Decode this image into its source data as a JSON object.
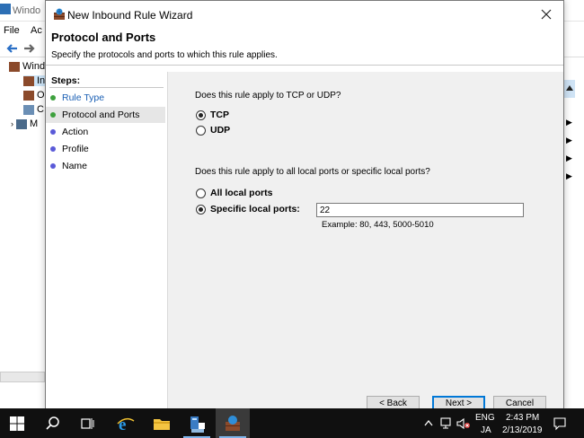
{
  "background_window": {
    "title": "Windo",
    "menu": [
      "File",
      "Ac"
    ],
    "tree_items": [
      "Wind",
      "In",
      "O",
      "C",
      "M"
    ]
  },
  "wizard": {
    "title": "New Inbound Rule Wizard",
    "heading": "Protocol and Ports",
    "subheading": "Specify the protocols and ports to which this rule applies.",
    "steps_title": "Steps:",
    "steps": [
      {
        "label": "Rule Type",
        "state": "done",
        "color": "#3ea13e"
      },
      {
        "label": "Protocol and Ports",
        "state": "current",
        "color": "#3ea13e"
      },
      {
        "label": "Action",
        "state": "pending",
        "color": "#5a5ad8"
      },
      {
        "label": "Profile",
        "state": "pending",
        "color": "#5a5ad8"
      },
      {
        "label": "Name",
        "state": "pending",
        "color": "#5a5ad8"
      }
    ],
    "protocol_question": "Does this rule apply to TCP or UDP?",
    "protocol_options": [
      "TCP",
      "UDP"
    ],
    "protocol_selected": "TCP",
    "ports_question": "Does this rule apply to all local ports or specific local ports?",
    "ports_options": [
      "All local ports",
      "Specific local ports:"
    ],
    "ports_selected": "Specific local ports:",
    "ports_value": "22",
    "ports_example": "Example: 80, 443, 5000-5010",
    "buttons": {
      "back": "< Back",
      "next": "Next >",
      "cancel": "Cancel"
    }
  },
  "taskbar": {
    "language": "ENG",
    "ime": "JA",
    "time": "2:43 PM",
    "date": "2/13/2019"
  },
  "colors": {
    "accent": "#0078d7",
    "step_done": "#3ea13e",
    "step_pending": "#5a5ad8",
    "taskbar": "#101010"
  }
}
